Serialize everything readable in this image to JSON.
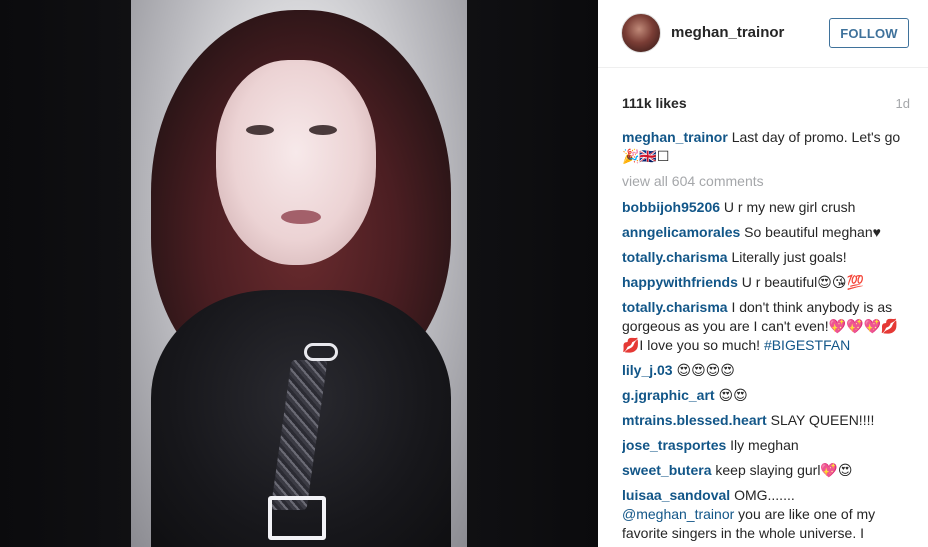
{
  "post": {
    "username": "meghan_trainor",
    "follow_label": "FOLLOW",
    "likes": "111k likes",
    "timestamp": "1d",
    "caption": "Last day of promo. Let's go🎉🇬🇧☐"
  },
  "view_all_comments": "view all 604 comments",
  "comments": [
    {
      "user": "bobbijoh95206",
      "text": "U r my new girl crush"
    },
    {
      "user": "anngelicamorales",
      "text": "So beautiful meghan♥"
    },
    {
      "user": "totally.charisma",
      "text": "Literally just goals!"
    },
    {
      "user": "happywithfriends",
      "text": "U r beautiful😍😘💯"
    },
    {
      "user": "totally.charisma",
      "text": "I don't think anybody is as gorgeous as you are I can't even!💖💖💖💋💋I love you so much!",
      "hashtag": "#BIGESTFAN"
    },
    {
      "user": "lily_j.03",
      "text": "😍😍😍😍"
    },
    {
      "user": "g.jgraphic_art",
      "text": "😍😍"
    },
    {
      "user": "mtrains.blessed.heart",
      "text": "SLAY QUEEN!!!!"
    },
    {
      "user": "jose_trasportes",
      "text": "Ily meghan"
    },
    {
      "user": "sweet_butera",
      "text": "keep slaying gurl💖😍"
    },
    {
      "user": "luisaa_sandoval",
      "text": "OMG.......",
      "mention": "@meghan_trainor",
      "text2": "you are like one of my favorite singers in the whole universe. I"
    }
  ]
}
